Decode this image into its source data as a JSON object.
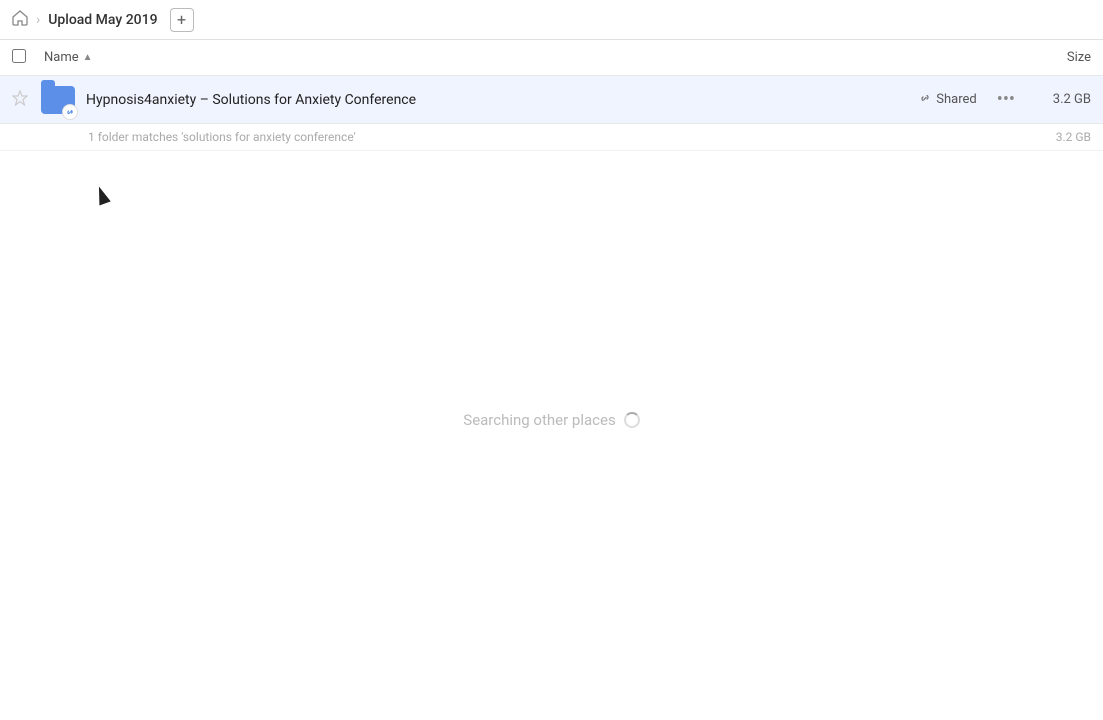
{
  "topbar": {
    "home_icon": "🏠",
    "separator": ">",
    "breadcrumb_title": "Upload May 2019",
    "add_button_label": "+"
  },
  "column_headers": {
    "checkbox_label": "",
    "name_label": "Name",
    "sort_arrow": "▲",
    "size_label": "Size"
  },
  "file_row": {
    "star": "★",
    "file_name": "Hypnosis4anxiety – Solutions for Anxiety Conference",
    "shared_label": "Shared",
    "more_icon": "•••",
    "file_size": "3.2 GB",
    "link_icon": "🔗"
  },
  "match_info": {
    "text": "1 folder matches 'solutions for anxiety conference'",
    "size": "3.2 GB"
  },
  "searching": {
    "text": "Searching other places"
  }
}
